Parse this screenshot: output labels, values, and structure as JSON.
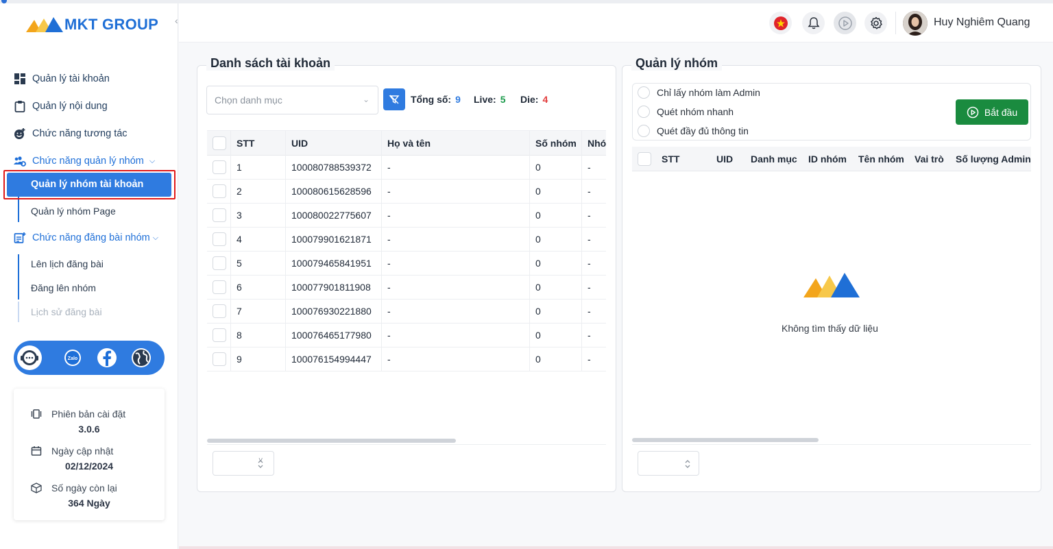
{
  "brand": {
    "name": "MKT GROUP"
  },
  "sidebar": {
    "collapse_glyph": "‹",
    "items": [
      {
        "label": "Quản lý tài khoản",
        "icon": "dashboard-icon"
      },
      {
        "label": "Quản lý nội dung",
        "icon": "clipboard-icon"
      },
      {
        "label": "Chức năng tương tác",
        "icon": "emoji-add-icon"
      },
      {
        "label": "Chức năng quản lý nhóm",
        "icon": "group-settings-icon"
      },
      {
        "label": "Chức năng đăng bài nhóm",
        "icon": "post-add-icon"
      }
    ],
    "group_sub": [
      "Quản lý nhóm tài khoản",
      "Quản lý nhóm Page"
    ],
    "post_sub": [
      "Lên lịch đăng bài",
      "Đăng lên nhóm",
      "Lịch sử đăng bài"
    ],
    "contacts": [
      "support-icon",
      "zalo-icon",
      "facebook-icon",
      "globe-icon"
    ],
    "zalo_label": "Zalo",
    "info": {
      "version_label": "Phiên bản cài đặt",
      "version": "3.0.6",
      "updated_label": "Ngày cập nhật",
      "updated": "02/12/2024",
      "days_label": "Số ngày còn lại",
      "days": "364 Ngày"
    }
  },
  "header": {
    "username": "Huy Nghiêm Quang"
  },
  "accounts": {
    "title": "Danh sách tài khoản",
    "category_placeholder": "Chọn danh mục",
    "total_label": "Tổng số:",
    "total": "9",
    "live_label": "Live:",
    "live": "5",
    "die_label": "Die:",
    "die": "4",
    "columns": [
      "STT",
      "UID",
      "Họ và tên",
      "Số nhóm",
      "Nhó"
    ],
    "rows": [
      [
        "1",
        "100080788539372",
        "-",
        "0",
        "-"
      ],
      [
        "2",
        "100080615628596",
        "-",
        "0",
        "-"
      ],
      [
        "3",
        "100080022775607",
        "-",
        "0",
        "-"
      ],
      [
        "4",
        "100079901621871",
        "-",
        "0",
        "-"
      ],
      [
        "5",
        "100079465841951",
        "-",
        "0",
        "-"
      ],
      [
        "6",
        "100077901811908",
        "-",
        "0",
        "-"
      ],
      [
        "7",
        "100076930221880",
        "-",
        "0",
        "-"
      ],
      [
        "8",
        "100076465177980",
        "-",
        "0",
        "-"
      ],
      [
        "9",
        "100076154994447",
        "-",
        "0",
        "-"
      ]
    ]
  },
  "groups": {
    "title": "Quản lý nhóm",
    "options": [
      "Chỉ lấy nhóm làm Admin",
      "Quét nhóm nhanh",
      "Quét đầy đủ thông tin"
    ],
    "start_label": "Bắt đầu",
    "columns": [
      "STT",
      "UID",
      "Danh mục",
      "ID nhóm",
      "Tên nhóm",
      "Vai trò",
      "Số lượng Admin"
    ],
    "empty_text": "Không tìm thấy dữ liệu"
  },
  "colors": {
    "primary": "#2f7be0",
    "success": "#1a8b3f",
    "live": "#1a9a4a",
    "die": "#e23b3b",
    "total": "#2f7be0"
  }
}
